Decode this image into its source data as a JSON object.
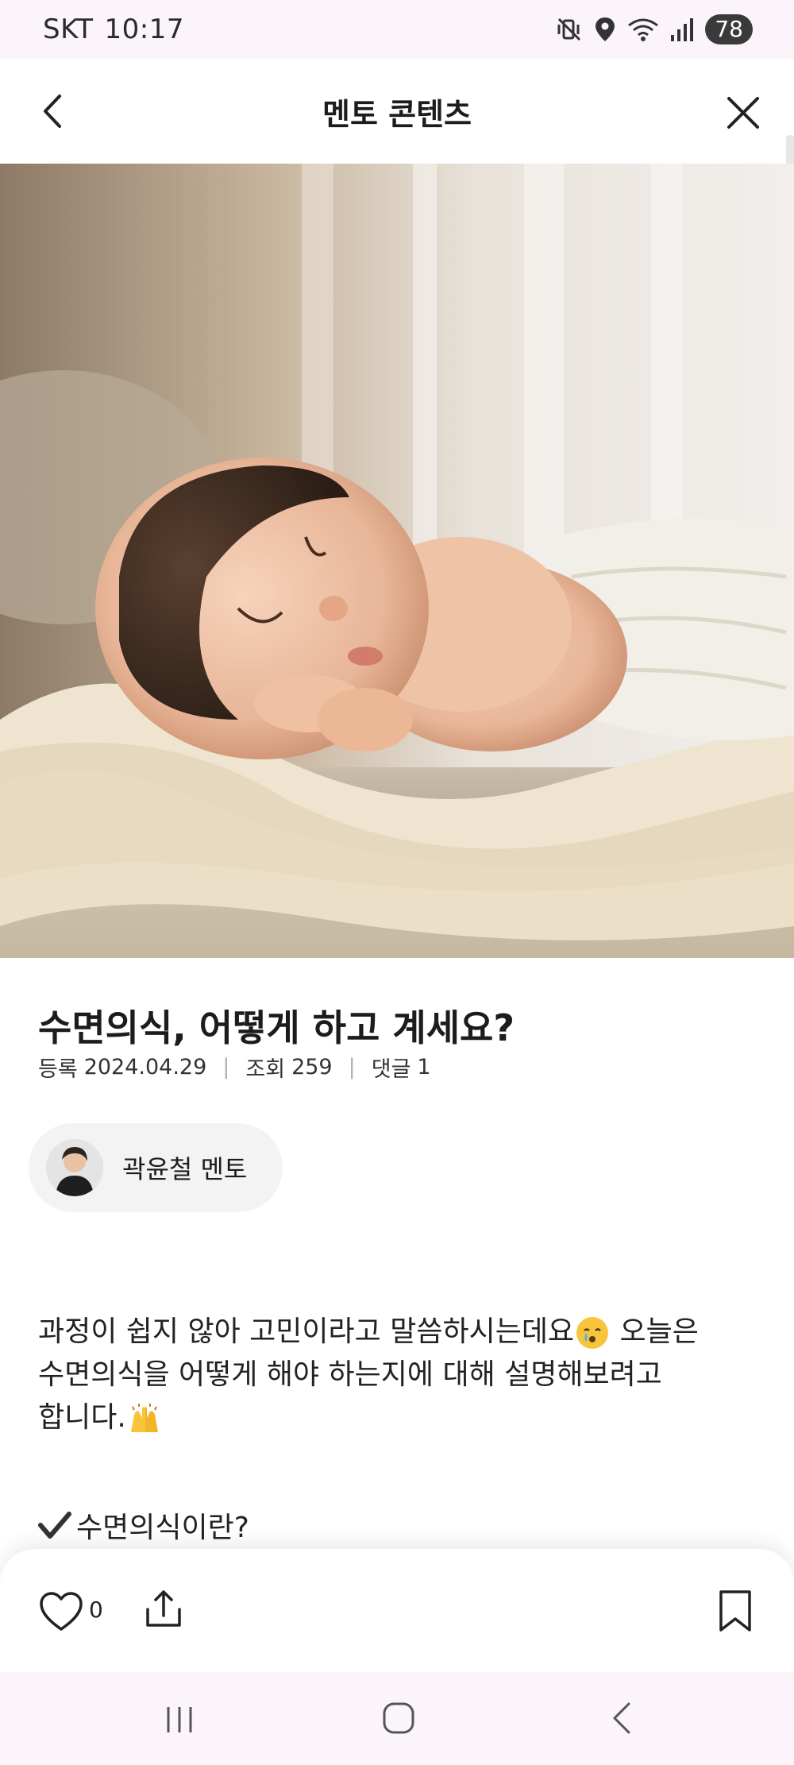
{
  "status_bar": {
    "carrier": "SKT",
    "time": "10:17",
    "battery": "78",
    "icons": [
      "mute-vibrate-icon",
      "location-icon",
      "wifi-icon",
      "signal-icon"
    ]
  },
  "header": {
    "title": "멘토 콘텐츠",
    "back_icon": "chevron-left-icon",
    "close_icon": "close-icon"
  },
  "hero": {
    "subject": "sleeping-baby-photo"
  },
  "article": {
    "title": "수면의식, 어떻게 하고 계세요?",
    "meta": {
      "registered_label": "등록",
      "registered_date": "2024.04.29",
      "views_label": "조회",
      "views": "259",
      "comments_label": "댓글",
      "comments": "1"
    },
    "mentor": {
      "name": "곽윤철 멘토"
    },
    "body": {
      "line1_a": "과정이 쉽지 않아 고민이라고 말씀하시는데요",
      "line1_b": " 오늘은",
      "line2": "수면의식을 어떻게 해야 하는지에 대해 설명해보려고",
      "line3": "합니다."
    },
    "section_heading": "수면의식이란?"
  },
  "actions": {
    "like_count": "0",
    "icons": [
      "heart-icon",
      "share-icon",
      "bookmark-icon"
    ]
  },
  "nav": {
    "icons": [
      "recent-apps-icon",
      "home-icon",
      "back-icon"
    ]
  },
  "colors": {
    "status_bg": "#fbf4fb",
    "chip_bg": "#f3f3f3",
    "text": "#1f1f1f"
  }
}
